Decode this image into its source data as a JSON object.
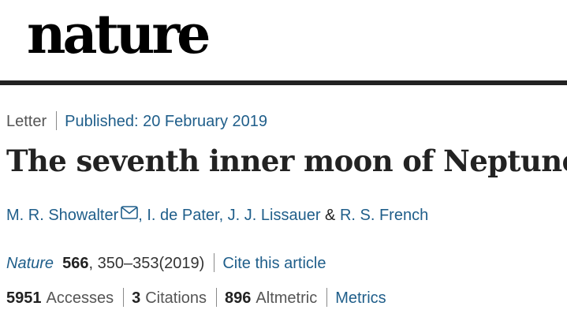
{
  "masthead": {
    "logo_text": "nature"
  },
  "article": {
    "type": "Letter",
    "published": "Published: 20 February 2019",
    "title": "The seventh inner moon of Neptune",
    "authors": [
      "M. R. Showalter",
      ", I. de Pater",
      ", J. J. Lissauer",
      " & ",
      "R. S. French"
    ],
    "contact_icon": "mail-icon",
    "citation": {
      "journal": "Nature",
      "volume": "566",
      "pages_year": ", 350–353(2019)",
      "cite_link": "Cite this article"
    },
    "metrics": {
      "accesses_count": "5951",
      "accesses_label": "Accesses",
      "citations_count": "3",
      "citations_label": "Citations",
      "altmetric_count": "896",
      "altmetric_label": "Altmetric",
      "metrics_link": "Metrics"
    }
  },
  "colors": {
    "link": "#1f5e8a",
    "text": "#222222",
    "rule": "#222222"
  }
}
